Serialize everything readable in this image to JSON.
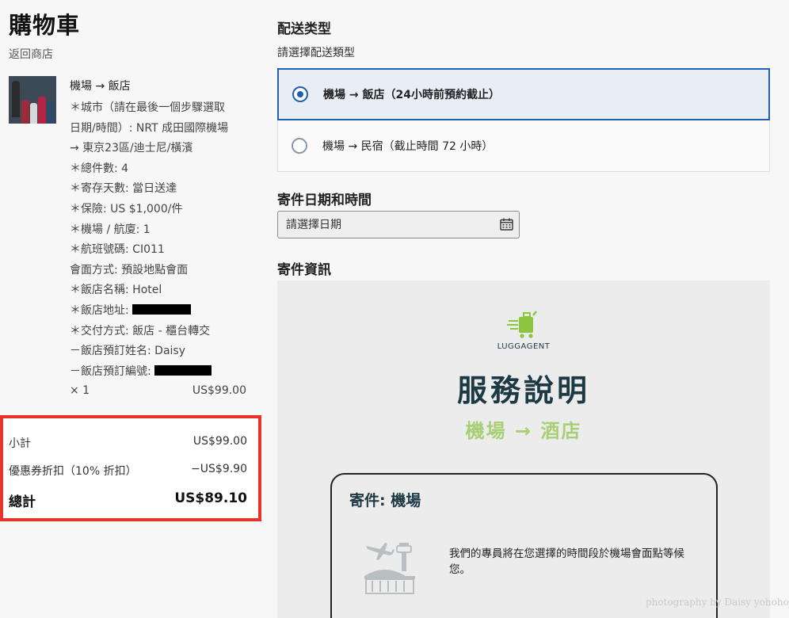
{
  "cart": {
    "title": "購物車",
    "back_link": "返回商店",
    "item": {
      "name": "機場 → 飯店",
      "options": [
        "＊城市（請在最後一個步驟選取",
        "日期/時間）: NRT 成田國際機場",
        "→ 東京23區/迪士尼/橫濱",
        "＊總件數: 4",
        "＊寄存天數: 當日送達",
        "＊保險: US $1,000/件",
        "＊機場 / 航廈: 1",
        "＊航班號碼: CI011",
        "會面方式: 預設地點會面",
        "＊飯店名稱: Hotel",
        "＊飯店地址: ",
        "＊交付方式: 飯店 - 櫃台轉交",
        "－飯店預訂姓名: Daisy",
        "－飯店預訂編號: "
      ],
      "quantity": "× 1",
      "price": "US$99.00"
    },
    "totals": {
      "subtotal_label": "小計",
      "subtotal_value": "US$99.00",
      "discount_label": "優惠券折扣（10% 折扣）",
      "discount_value": "−US$9.90",
      "total_label": "總計",
      "total_value": "US$89.10"
    }
  },
  "delivery": {
    "section_title": "配送类型",
    "prompt": "請選擇配送類型",
    "options": [
      {
        "label": "機場 → 飯店（24小時前預約截止）",
        "selected": true
      },
      {
        "label": "機場 → 民宿（截止時間 72 小時）",
        "selected": false
      }
    ],
    "date_title": "寄件日期和時間",
    "date_placeholder": "請選擇日期",
    "info_title": "寄件資訊"
  },
  "info_panel": {
    "logo_text": "LUGGAGENT",
    "title": "服務說明",
    "subtitle": "機場 → 酒店",
    "card_title": "寄件: 機場",
    "card_text": "我們的專員將在您選擇的時間段於機場會面點等候您。"
  },
  "watermark": "photography by Daisy yohoho",
  "colors": {
    "accent_blue": "#1f5fb2",
    "highlight_red": "#e9332a",
    "brand_green": "#a9cf76",
    "brand_dark": "#1d3a44"
  },
  "icons": {
    "radio": "radio-button-icon",
    "calendar": "calendar-icon",
    "logo": "luggage-cart-logo-icon",
    "airport": "airport-plane-icon"
  }
}
